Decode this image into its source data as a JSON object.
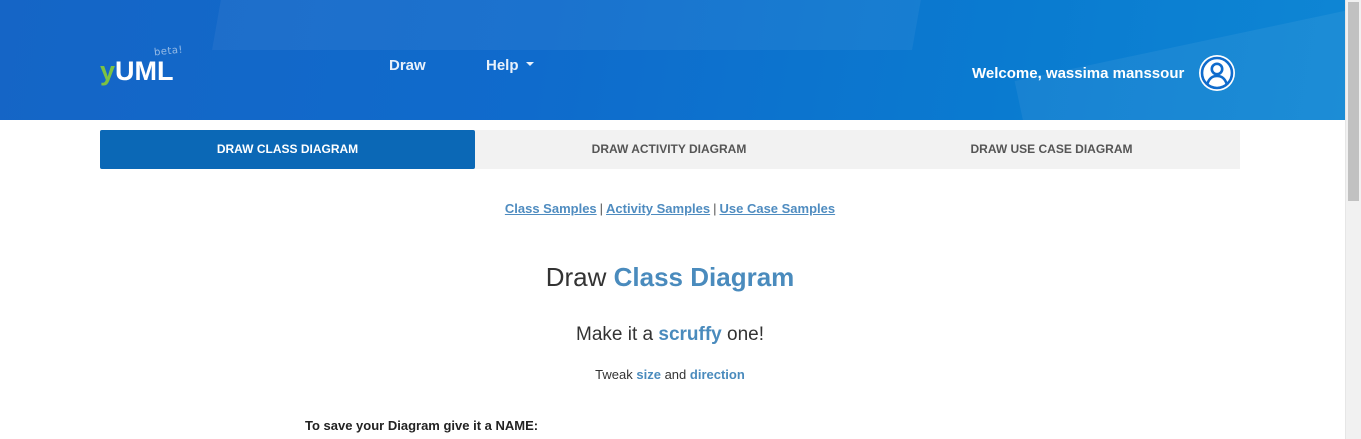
{
  "brand": {
    "logo_y": "y",
    "logo_uml": "UML",
    "beta": "beta!"
  },
  "nav": {
    "draw": "Draw",
    "help": "Help"
  },
  "user": {
    "welcome": "Welcome, wassima manssour",
    "avatar_icon": "user-circle-icon"
  },
  "tabs": [
    {
      "label": "DRAW CLASS DIAGRAM",
      "active": true
    },
    {
      "label": "DRAW ACTIVITY DIAGRAM",
      "active": false
    },
    {
      "label": "DRAW USE CASE DIAGRAM",
      "active": false
    }
  ],
  "samples": {
    "class": "Class Samples",
    "activity": "Activity Samples",
    "use_case": "Use Case Samples",
    "separator": "|"
  },
  "heading": {
    "prefix": "Draw",
    "accent": "Class Diagram"
  },
  "scruffy": {
    "prefix": "Make it a",
    "accent": "scruffy",
    "suffix": "one!"
  },
  "tweak": {
    "prefix": "Tweak",
    "size": "size",
    "and": "and",
    "direction": "direction"
  },
  "save": {
    "label": "To save your Diagram give it a NAME:"
  },
  "colors": {
    "header_blue": "#1565c6",
    "active_tab": "#0b68b6",
    "accent_text": "#4a8bbd",
    "logo_green": "#7cc242"
  }
}
